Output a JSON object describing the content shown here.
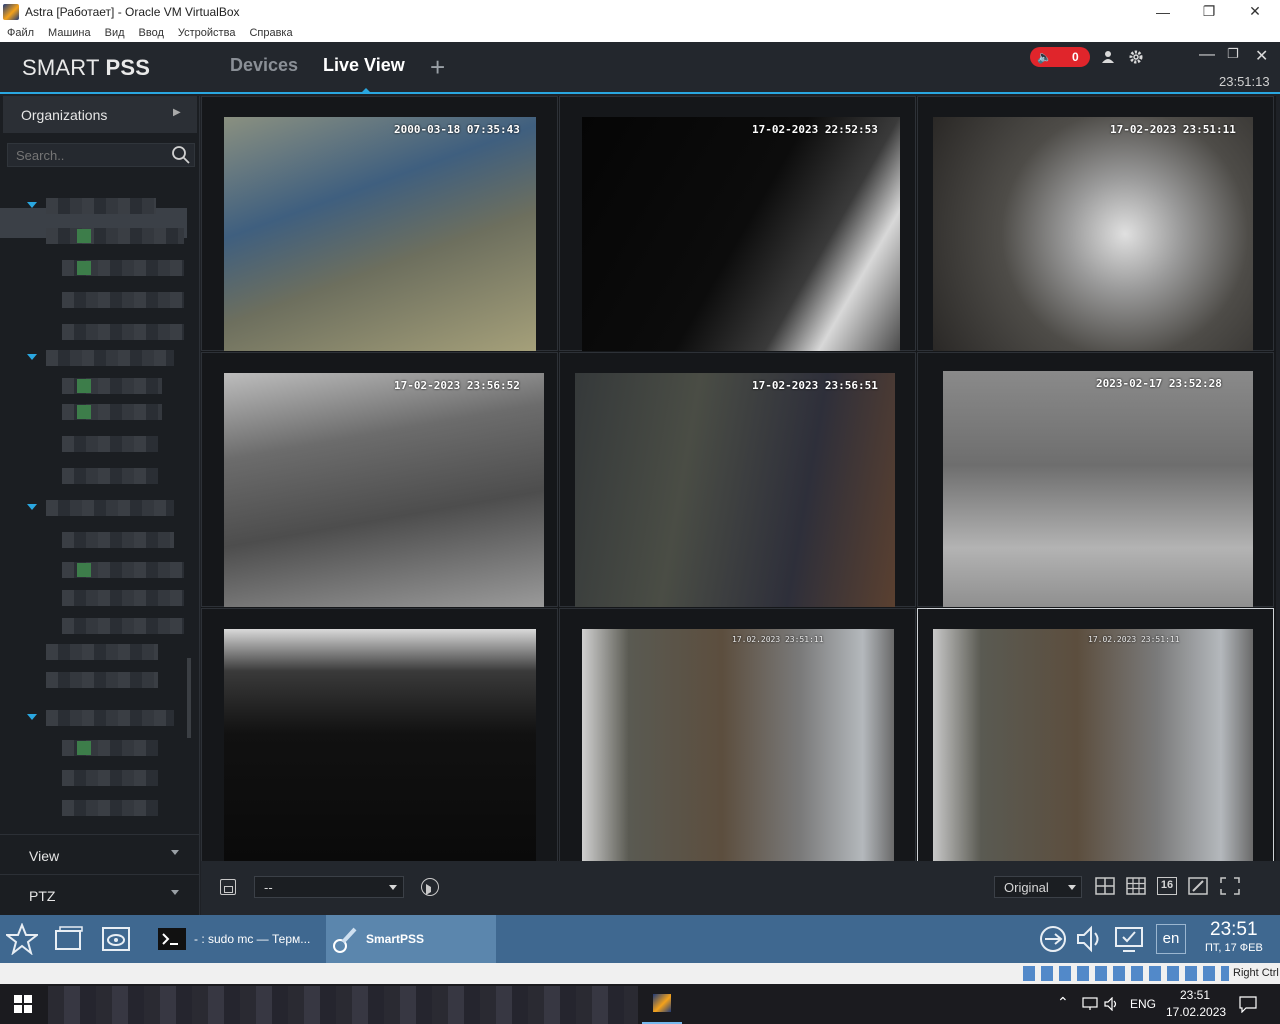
{
  "vbox": {
    "title": "Astra [Работает] - Oracle VM VirtualBox",
    "menu": [
      "Файл",
      "Машина",
      "Вид",
      "Ввод",
      "Устройства",
      "Справка"
    ],
    "status_hostkey": "Right Ctrl"
  },
  "app": {
    "brand_light": "SMART",
    "brand_bold": "PSS",
    "tabs": [
      "Devices",
      "Live View"
    ],
    "active_tab": "Live View",
    "alarm_count": "0",
    "clock": "23:51:13",
    "accent_color": "#2aa7e0",
    "alarm_color": "#e0252b"
  },
  "sidebar": {
    "organizations_label": "Organizations",
    "search_placeholder": "Search..",
    "sections": [
      "View",
      "PTZ"
    ]
  },
  "grid": {
    "cells": [
      {
        "timestamp": "2000-03-18 07:35:43"
      },
      {
        "timestamp": "17-02-2023 22:52:53"
      },
      {
        "timestamp": "17-02-2023 23:51:11"
      },
      {
        "timestamp": "17-02-2023 23:56:52"
      },
      {
        "timestamp": "17-02-2023 23:56:51"
      },
      {
        "timestamp": "2023-02-17 23:52:28"
      },
      {
        "timestamp": ""
      },
      {
        "timestamp": "17.02.2023 23:51:11"
      },
      {
        "timestamp": "17.02.2023 23:51:11"
      }
    ]
  },
  "toolbar": {
    "view_select_value": "--",
    "ratio_value": "Original",
    "split_16_label": "16"
  },
  "astra": {
    "task_terminal": "- : sudo mc — Терм...",
    "task_smartpss": "SmartPSS",
    "lang": "en",
    "time": "23:51",
    "date": "ПТ, 17 ФЕВ"
  },
  "windows": {
    "lang": "ENG",
    "time": "23:51",
    "date": "17.02.2023"
  }
}
